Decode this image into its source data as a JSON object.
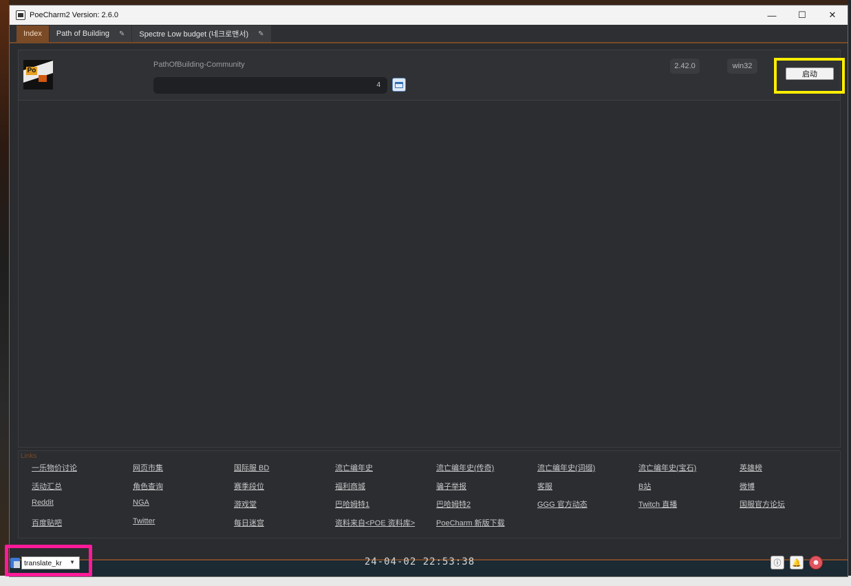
{
  "window": {
    "title": "PoeCharm2 Version: 2.6.0"
  },
  "win_controls": {
    "minimize": "—",
    "maximize": "☐",
    "close": "✕"
  },
  "tabs": [
    {
      "label": "Index"
    },
    {
      "label": "Path of Building"
    },
    {
      "label": "Spectre Low budget (네크로맨서)"
    }
  ],
  "app": {
    "name": "PathOfBuilding-Community",
    "progress_value": "4",
    "version": "2.42.0",
    "platform": "win32",
    "launch_label": "启动"
  },
  "links": {
    "title": "Links",
    "items": [
      "一乐物价讨论",
      "网页市集",
      "国际服 BD",
      "流亡编年史",
      "流亡编年史(传奇)",
      "流亡编年史(词缀)",
      "流亡编年史(宝石)",
      "英雄榜",
      "活动汇总",
      "角色查询",
      "赛季段位",
      "福利商城",
      "骗子举报",
      "客服",
      "B站",
      "微博",
      "Reddit",
      "NGA",
      "游戏堂",
      "巴哈姆特1",
      "巴哈姆特2",
      "GGG 官方动态",
      "Twitch 直播",
      "国服官方论坛",
      "百度贴吧",
      "Twitter",
      "每日迷宫",
      "资料来自<POE 资料库>",
      "PoeCharm 新版下载"
    ]
  },
  "status": {
    "language": "translate_kr",
    "datetime": "24-04-02 22:53:38"
  },
  "colors": {
    "accent": "#7a4a27",
    "highlight_yellow": "#ffee00",
    "highlight_pink": "#ff1a9a"
  }
}
